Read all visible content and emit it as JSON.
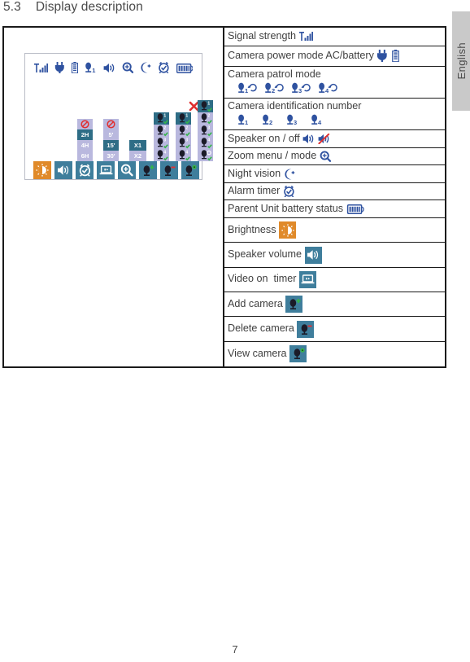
{
  "heading": {
    "number": "5.3",
    "title": "Display description"
  },
  "language_tab": {
    "label": "English"
  },
  "page": {
    "number": "7"
  },
  "table": {
    "rows": [
      {
        "id": "signal-strength",
        "label": "Signal strength ",
        "icons": [
          "signal-bars-icon"
        ]
      },
      {
        "id": "camera-power-mode",
        "label": "Camera power mode AC/battery ",
        "icons": [
          "power-plug-icon",
          "battery-icon"
        ]
      },
      {
        "id": "camera-patrol-mode",
        "label": "Camera patrol mode",
        "icons": [
          "camera-1-patrol-icon",
          "camera-2-patrol-icon",
          "camera-3-patrol-icon",
          "camera-4-patrol-icon"
        ],
        "two_line": true
      },
      {
        "id": "camera-id-number",
        "label": "Camera identification number",
        "icons": [
          "camera-1-icon",
          "camera-2-icon",
          "camera-3-icon",
          "camera-4-icon"
        ],
        "two_line": true
      },
      {
        "id": "speaker-on-off",
        "label": "Speaker on / off ",
        "icons": [
          "speaker-on-icon",
          "speaker-mute-icon"
        ]
      },
      {
        "id": "zoom-menu-mode",
        "label": "Zoom menu / mode ",
        "icons": [
          "magnifier-icon"
        ]
      },
      {
        "id": "night-vision",
        "label": "Night vision ",
        "icons": [
          "moon-star-icon"
        ]
      },
      {
        "id": "alarm-timer",
        "label": "Alarm timer ",
        "icons": [
          "alarm-clock-icon"
        ]
      },
      {
        "id": "parent-battery",
        "label": "Parent Unit battery status ",
        "icons": [
          "battery-full-icon"
        ]
      },
      {
        "id": "brightness",
        "label": "Brightness ",
        "icons": [
          "brightness-button-icon"
        ]
      },
      {
        "id": "speaker-volume",
        "label": "Speaker volume ",
        "icons": [
          "volume-button-icon"
        ]
      },
      {
        "id": "video-on-timer",
        "label": "Video on  timer ",
        "icons": [
          "video-timer-button-icon"
        ]
      },
      {
        "id": "add-camera",
        "label": "Add camera ",
        "icons": [
          "add-camera-button-icon"
        ]
      },
      {
        "id": "delete-camera",
        "label": "Delete camera ",
        "icons": [
          "delete-camera-button-icon"
        ]
      },
      {
        "id": "view-camera",
        "label": "View camera ",
        "icons": [
          "view-camera-button-icon"
        ]
      }
    ]
  },
  "lcd": {
    "status_icons": [
      "signal-bars-icon",
      "power-plug-icon",
      "battery-icon",
      "camera-1-icon",
      "speaker-on-icon",
      "magnifier-icon",
      "moon-star-icon",
      "alarm-clock-icon",
      "battery-full-icon"
    ],
    "menu_buttons": [
      {
        "id": "brightness",
        "icon": "brightness-button-icon"
      },
      {
        "id": "volume",
        "icon": "volume-button-icon"
      },
      {
        "id": "alarm-timer",
        "icon": "alarm-clock-button-icon"
      },
      {
        "id": "video-timer",
        "icon": "video-timer-button-icon"
      },
      {
        "id": "zoom",
        "icon": "magnifier-button-icon"
      },
      {
        "id": "add-camera",
        "icon": "add-camera-button-icon"
      },
      {
        "id": "delete-camera",
        "icon": "delete-camera-button-icon"
      },
      {
        "id": "view-camera",
        "icon": "view-camera-button-icon"
      }
    ],
    "menu_columns": [
      {
        "id": "alarm-timer-options",
        "options": [
          {
            "text": "",
            "icon": "no-entry-icon",
            "selected": false
          },
          {
            "text": "2H",
            "selected": true
          },
          {
            "text": "4H",
            "selected": false
          },
          {
            "text": "6H",
            "selected": false
          }
        ]
      },
      {
        "id": "video-timer-options",
        "options": [
          {
            "text": "",
            "icon": "no-entry-icon",
            "selected": false
          },
          {
            "text": "5'",
            "selected": false
          },
          {
            "text": "15'",
            "selected": true
          },
          {
            "text": "30'",
            "selected": false
          }
        ]
      },
      {
        "id": "zoom-options",
        "options": [
          {
            "text": "X1",
            "selected": true
          },
          {
            "text": "X2",
            "selected": false
          }
        ]
      },
      {
        "id": "add-camera-options",
        "options": [
          {
            "text": "1",
            "selected": true,
            "check": true
          },
          {
            "text": "2",
            "selected": false,
            "check": true
          },
          {
            "text": "3",
            "selected": false,
            "check": true
          },
          {
            "text": "4",
            "selected": false,
            "check": true
          }
        ]
      },
      {
        "id": "delete-camera-options",
        "options": [
          {
            "text": "1",
            "selected": true,
            "check": true
          },
          {
            "text": "2",
            "selected": false,
            "check": true
          },
          {
            "text": "3",
            "selected": false,
            "check": true
          },
          {
            "text": "4",
            "selected": false,
            "check": true
          }
        ]
      },
      {
        "id": "view-camera-options",
        "options": [
          {
            "text": "1",
            "selected": true,
            "check": true
          },
          {
            "text": "2",
            "selected": false,
            "check": true
          },
          {
            "text": "3",
            "selected": false,
            "check": true
          },
          {
            "text": "4",
            "selected": false,
            "check": true
          },
          {
            "text": "",
            "selected": false,
            "check": true,
            "icon": "scan-icon"
          }
        ]
      }
    ],
    "delete_marker": "x-mark-icon"
  },
  "colors": {
    "icon_navy": "#2f52a0",
    "button_blue": "#3f7e9c",
    "button_orange": "#e08a2a",
    "option_unselected": "#b9b8de",
    "option_selected": "#2e6d86",
    "check_green": "#35b44a",
    "x_red": "#e03030",
    "tab_gray": "#c9c9c9"
  }
}
